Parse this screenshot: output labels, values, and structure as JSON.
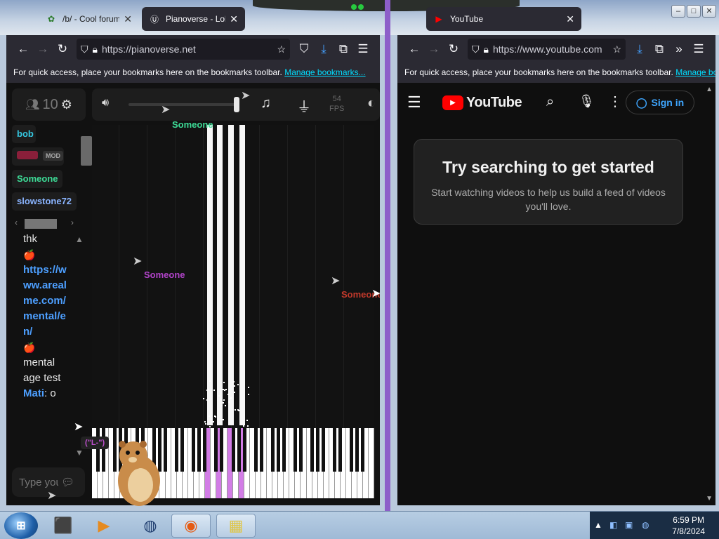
{
  "tabs": [
    {
      "title": "/b/ - Cool forum",
      "favicon": "forum-icon",
      "active": false
    },
    {
      "title": "Pianoverse - Lobby",
      "favicon": "pianoverse-icon",
      "active": true
    },
    {
      "title": "YouTube",
      "favicon": "youtube-icon",
      "active": true
    }
  ],
  "left_browser": {
    "url": "https://pianoverse.net",
    "bookmarks_text": "For quick access, place your bookmarks here on the bookmarks toolbar.",
    "bookmarks_link": "Manage bookmarks..."
  },
  "right_browser": {
    "url": "https://www.youtube.com",
    "bookmarks_text": "For quick access, place your bookmarks here on the bookmarks toolbar.",
    "bookmarks_link": "Manage bookmarks..."
  },
  "pianoverse": {
    "user_count": "10",
    "fps_value": "54",
    "fps_label": "FPS",
    "users": [
      {
        "name": "bob",
        "color": "#35c7e0"
      },
      {
        "name": "",
        "color": "#8a1f3a",
        "badge": "MOD"
      },
      {
        "name": "Someone",
        "color": "#3ddc97"
      },
      {
        "name": "slowstone72",
        "color": "#8ab4ff"
      }
    ],
    "chat": {
      "msg1": "thk",
      "apple": "🍎",
      "link": "https://www.arealme.com/mental/en/",
      "msg2": "mental age test",
      "author": "Mati",
      "author_msg": ": o"
    },
    "chat_placeholder": "Type your message",
    "emote": "(\"L-\")",
    "cursors": [
      {
        "label": "Someone",
        "color": "#3ddc97"
      },
      {
        "label": "Someone",
        "color": "#b043c8"
      },
      {
        "label": "Someone",
        "color": "#c0392b"
      }
    ]
  },
  "youtube": {
    "brand": "YouTube",
    "signin": "Sign in",
    "card_title": "Try searching to get started",
    "card_text": "Start watching videos to help us build a feed of videos you'll love."
  },
  "taskbar": {
    "time": "6:59 PM",
    "date": "7/8/2024"
  }
}
